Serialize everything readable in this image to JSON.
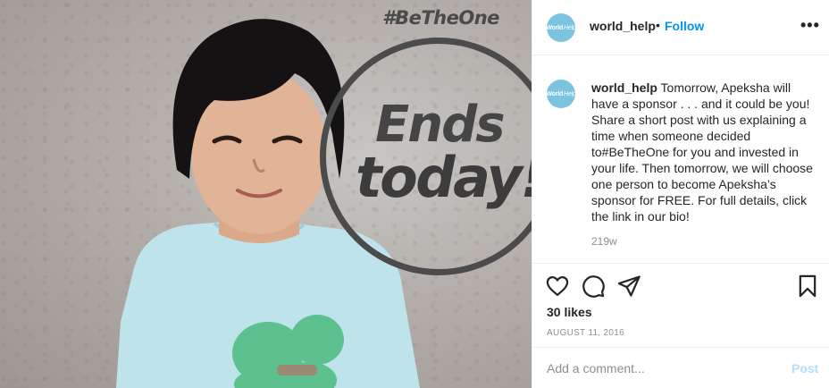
{
  "post_image": {
    "hashtag": "#BeTheOne",
    "headline_line1": "Ends",
    "headline_line2": "today!"
  },
  "header": {
    "avatar_text": "World",
    "avatar_text_light": "Help",
    "username": "world_help",
    "separator": "•",
    "follow_label": "Follow",
    "more_label": "•••"
  },
  "caption": {
    "username": "world_help",
    "line1": "Tomorrow, Apeksha will have a sponsor . . . and it could be you!",
    "line2": "Share a short post with us explaining a time when someone decided to#BeTheOne for you and invested in your life. Then tomorrow, we will choose one person to become Apeksha’s sponsor for FREE. For full details, click the link in our bio!",
    "time": "219w"
  },
  "actions": {
    "like_icon": "heart-icon",
    "comment_icon": "comment-icon",
    "share_icon": "paper-plane-icon",
    "save_icon": "bookmark-icon",
    "likes": "30 likes",
    "date": "AUGUST 11, 2016"
  },
  "add_comment": {
    "placeholder": "Add a comment...",
    "post_label": "Post"
  },
  "colors": {
    "accent": "#0095f6",
    "post_disabled": "#b2dffc",
    "avatar": "#7cc3e0",
    "shirt": "#bfe3ea",
    "butterfly": "#5cc18f"
  }
}
